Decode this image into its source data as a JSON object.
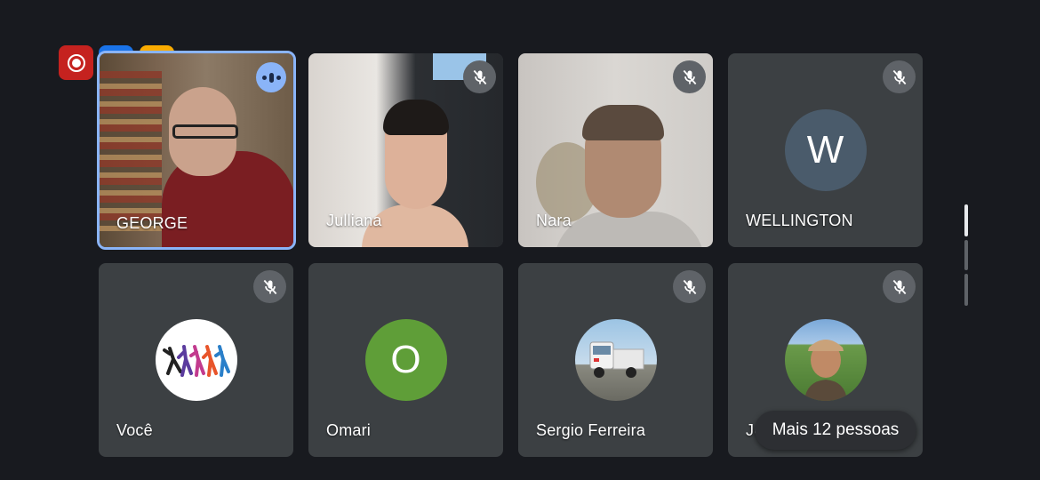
{
  "participants": [
    {
      "name": "GEORGE",
      "speaking": true
    },
    {
      "name": "Julliana",
      "muted": true
    },
    {
      "name": "Nara",
      "muted": true
    },
    {
      "name": "WELLINGTON",
      "muted": true,
      "initial": "W",
      "avatar_color": "#4a5b6b"
    },
    {
      "name": "Você",
      "muted": true
    },
    {
      "name": "Omari",
      "initial": "O",
      "avatar_color": "#5f9e38"
    },
    {
      "name": "Sergio Ferreira",
      "muted": true
    },
    {
      "name": "Jo",
      "muted": true
    }
  ],
  "more_people": "Mais 12 pessoas",
  "status_badges": [
    {
      "icon": "record-icon",
      "color": "#c5221f"
    },
    {
      "icon": "transcript-icon",
      "color": "#1a73e8"
    },
    {
      "icon": "no-recording-icon",
      "color": "#f9ab00"
    }
  ],
  "colors": {
    "background": "#181a1f",
    "tile": "#3c4043",
    "speaking_border": "#8ab4f8"
  }
}
